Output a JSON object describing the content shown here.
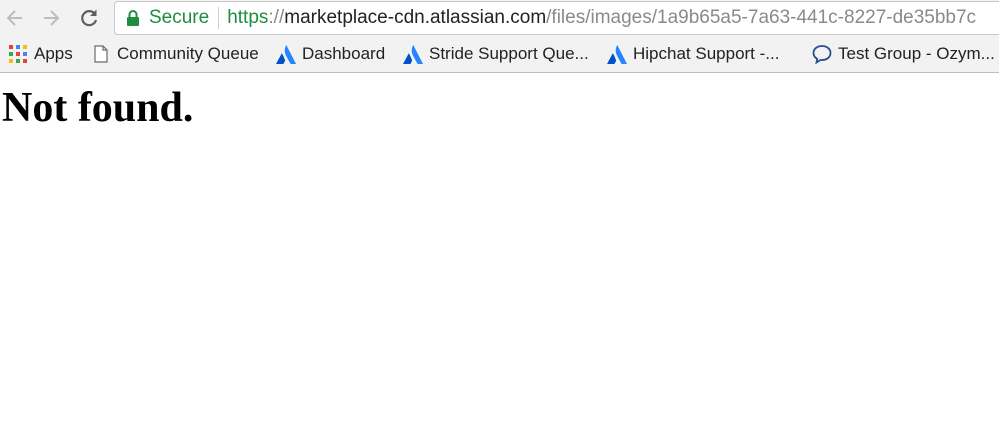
{
  "toolbar": {
    "security_label": "Secure",
    "url": {
      "scheme": "https",
      "separator": "://",
      "host": "marketplace-cdn.atlassian.com",
      "path": "/files/images/1a9b65a5-7a63-441c-8227-de35bb7c"
    }
  },
  "bookmarks": [
    {
      "label": "Apps",
      "icon": "apps-grid-icon"
    },
    {
      "label": "Community Queue",
      "icon": "document-icon"
    },
    {
      "label": "Dashboard",
      "icon": "atlassian-logo-icon"
    },
    {
      "label": "Stride Support Que...",
      "icon": "atlassian-logo-icon"
    },
    {
      "label": "Hipchat Support -...",
      "icon": "atlassian-logo-icon"
    },
    {
      "label": "Test Group - Ozym...",
      "icon": "speech-bubble-icon"
    }
  ],
  "page": {
    "heading": "Not found."
  },
  "colors": {
    "secure_green": "#1e8e3e",
    "atlassian_blue": "#2684ff",
    "toolbar_gray": "#f2f2f2"
  }
}
